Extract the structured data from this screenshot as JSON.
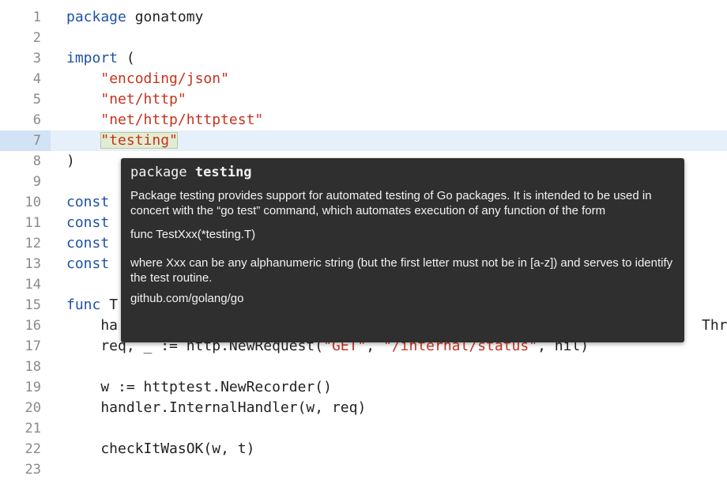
{
  "editor": {
    "lines": [
      {
        "n": "1",
        "segments": [
          {
            "t": "package",
            "c": "kw"
          },
          {
            "t": " gonatomy",
            "c": ""
          }
        ]
      },
      {
        "n": "2",
        "segments": []
      },
      {
        "n": "3",
        "segments": [
          {
            "t": "import",
            "c": "kw"
          },
          {
            "t": " (",
            "c": ""
          }
        ]
      },
      {
        "n": "4",
        "segments": [
          {
            "t": "    ",
            "c": ""
          },
          {
            "t": "\"encoding/json\"",
            "c": "str"
          }
        ]
      },
      {
        "n": "5",
        "segments": [
          {
            "t": "    ",
            "c": ""
          },
          {
            "t": "\"net/http\"",
            "c": "str"
          }
        ]
      },
      {
        "n": "6",
        "segments": [
          {
            "t": "    ",
            "c": ""
          },
          {
            "t": "\"net/http/httptest\"",
            "c": "str"
          }
        ]
      },
      {
        "n": "7",
        "segments": [
          {
            "t": "    ",
            "c": ""
          },
          {
            "t": "\"testing\"",
            "c": "str cursor-box"
          }
        ],
        "current": true
      },
      {
        "n": "8",
        "segments": [
          {
            "t": ")",
            "c": ""
          }
        ]
      },
      {
        "n": "9",
        "segments": []
      },
      {
        "n": "10",
        "segments": [
          {
            "t": "const",
            "c": "kw"
          }
        ]
      },
      {
        "n": "11",
        "segments": [
          {
            "t": "const",
            "c": "kw"
          }
        ]
      },
      {
        "n": "12",
        "segments": [
          {
            "t": "const",
            "c": "kw"
          }
        ]
      },
      {
        "n": "13",
        "segments": [
          {
            "t": "const",
            "c": "kw"
          }
        ]
      },
      {
        "n": "14",
        "segments": []
      },
      {
        "n": "15",
        "segments": [
          {
            "t": "func",
            "c": "kw"
          },
          {
            "t": " T",
            "c": ""
          }
        ]
      },
      {
        "n": "16",
        "segments": [
          {
            "t": "    ha",
            "c": ""
          }
        ]
      },
      {
        "n": "17",
        "segments": [
          {
            "t": "    req, _ := http.NewRequest(",
            "c": ""
          },
          {
            "t": "\"GET\"",
            "c": "str"
          },
          {
            "t": ", ",
            "c": ""
          },
          {
            "t": "\"/internal/status\"",
            "c": "str"
          },
          {
            "t": ", nil)",
            "c": ""
          }
        ]
      },
      {
        "n": "18",
        "segments": []
      },
      {
        "n": "19",
        "segments": [
          {
            "t": "    w := httptest.NewRecorder()",
            "c": ""
          }
        ]
      },
      {
        "n": "20",
        "segments": [
          {
            "t": "    handler.InternalHandler(w, req)",
            "c": ""
          }
        ]
      },
      {
        "n": "21",
        "segments": []
      },
      {
        "n": "22",
        "segments": [
          {
            "t": "    checkItWasOK(w, t)",
            "c": ""
          }
        ]
      },
      {
        "n": "23",
        "segments": []
      }
    ],
    "line16_tail": "Thr"
  },
  "tooltip": {
    "title_prefix": "package ",
    "title_name": "testing",
    "description": "Package testing provides support for automated testing of Go packages. It is intended to be used in concert with the “go test” command, which automates execution of any function of the form",
    "signature": "func TestXxx(*testing.T)",
    "details": "where Xxx can be any alphanumeric string (but the first letter must not be in [a-z]) and serves to identify the test routine.",
    "source": "github.com/golang/go"
  },
  "colors": {
    "keyword": "#1f52a5",
    "string": "#c8321e",
    "current_line": "#e6f0fb",
    "tooltip_bg": "#2f2f2f"
  }
}
